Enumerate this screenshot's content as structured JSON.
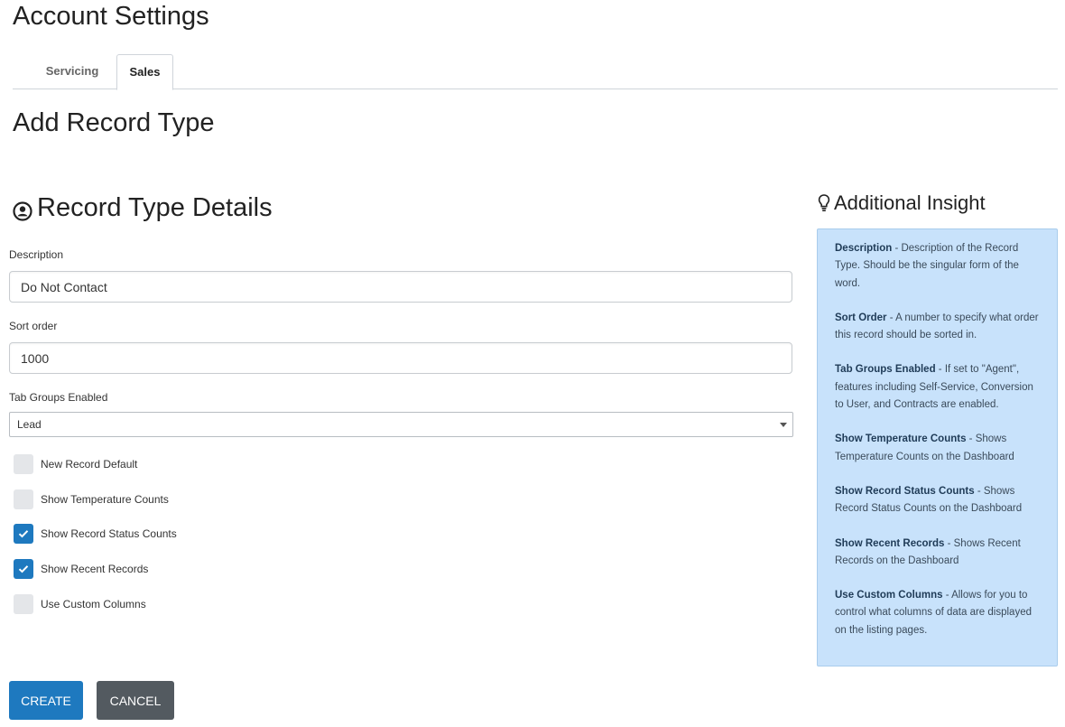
{
  "page": {
    "title": "Account Settings"
  },
  "tabs": [
    {
      "label": "Servicing",
      "active": false
    },
    {
      "label": "Sales",
      "active": true
    }
  ],
  "section": {
    "title": "Add Record Type"
  },
  "details": {
    "title": "Record Type Details",
    "icon": "person-circle-icon",
    "description": {
      "label": "Description",
      "value": "Do Not Contact"
    },
    "sort_order": {
      "label": "Sort order",
      "value": "1000"
    },
    "tab_groups": {
      "label": "Tab Groups Enabled",
      "value": "Lead"
    },
    "checkboxes": [
      {
        "label": "New Record Default",
        "checked": false
      },
      {
        "label": "Show Temperature Counts",
        "checked": false
      },
      {
        "label": "Show Record Status Counts",
        "checked": true
      },
      {
        "label": "Show Recent Records",
        "checked": true
      },
      {
        "label": "Use Custom Columns",
        "checked": false
      }
    ]
  },
  "buttons": {
    "create": "CREATE",
    "cancel": "CANCEL"
  },
  "insight": {
    "title": "Additional Insight",
    "icon": "lightbulb-icon",
    "items": [
      {
        "term": "Description",
        "text": " - Description of the Record Type. Should be the singular form of the word."
      },
      {
        "term": "Sort Order",
        "text": " - A number to specify what order this record should be sorted in."
      },
      {
        "term": "Tab Groups Enabled",
        "text": " - If set to \"Agent\", features including Self-Service, Conversion to User, and Contracts are enabled."
      },
      {
        "term": "Show Temperature Counts",
        "text": " - Shows Temperature Counts on the Dashboard"
      },
      {
        "term": "Show Record Status Counts",
        "text": " - Shows Record Status Counts on the Dashboard"
      },
      {
        "term": "Show Recent Records",
        "text": " - Shows Recent Records on the Dashboard"
      },
      {
        "term": "Use Custom Columns",
        "text": " - Allows for you to control what columns of data are displayed on the listing pages."
      }
    ]
  },
  "colors": {
    "primary": "#1e79bf",
    "secondary": "#535a60",
    "insight_bg": "#c8e2fb"
  }
}
